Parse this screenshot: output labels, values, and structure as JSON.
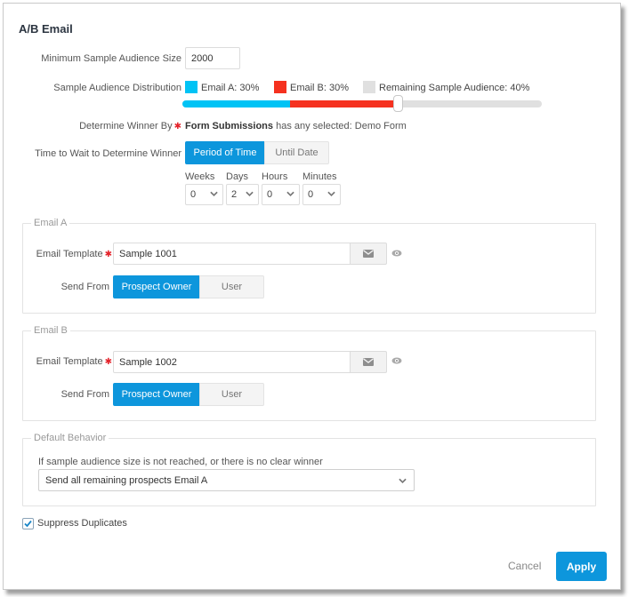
{
  "dialog": {
    "title": "A/B Email",
    "min_sample": {
      "label": "Minimum Sample Audience Size",
      "value": "2000"
    },
    "distribution": {
      "label": "Sample Audience Distribution",
      "legend": [
        {
          "label": "Email A: 30%",
          "color": "#00c3f5"
        },
        {
          "label": "Email B: 30%",
          "color": "#f5311f"
        },
        {
          "label": "Remaining Sample Audience: 40%",
          "color": "#e0e0e0"
        }
      ],
      "email_a_percent": 30,
      "email_b_percent": 30,
      "remaining_percent": 40
    },
    "winner": {
      "label": "Determine Winner By",
      "required_mark": "✱",
      "criteria_bold": "Form Submissions",
      "criteria_rest": " has any selected: Demo Form"
    },
    "wait": {
      "label": "Time to Wait to Determine Winner",
      "options": [
        "Period of Time",
        "Until Date"
      ],
      "selected": "Period of Time",
      "units": [
        {
          "label": "Weeks",
          "value": "0"
        },
        {
          "label": "Days",
          "value": "2"
        },
        {
          "label": "Hours",
          "value": "0"
        },
        {
          "label": "Minutes",
          "value": "0"
        }
      ]
    },
    "email_a": {
      "legend": "Email A",
      "template_label": "Email Template",
      "template_value": "Sample 1001",
      "send_from_label": "Send From",
      "send_from_options": [
        "Prospect Owner",
        "User"
      ],
      "send_from_selected": "Prospect Owner"
    },
    "email_b": {
      "legend": "Email B",
      "template_label": "Email Template",
      "template_value": "Sample 1002",
      "send_from_label": "Send From",
      "send_from_options": [
        "Prospect Owner",
        "User"
      ],
      "send_from_selected": "Prospect Owner"
    },
    "default_behavior": {
      "legend": "Default Behavior",
      "description": "If sample audience size is not reached, or there is no clear winner",
      "selected": "Send all remaining prospects Email A"
    },
    "suppress": {
      "label": "Suppress Duplicates",
      "checked": true
    },
    "footer": {
      "cancel": "Cancel",
      "apply": "Apply"
    },
    "accent_color": "#0d96dc"
  }
}
